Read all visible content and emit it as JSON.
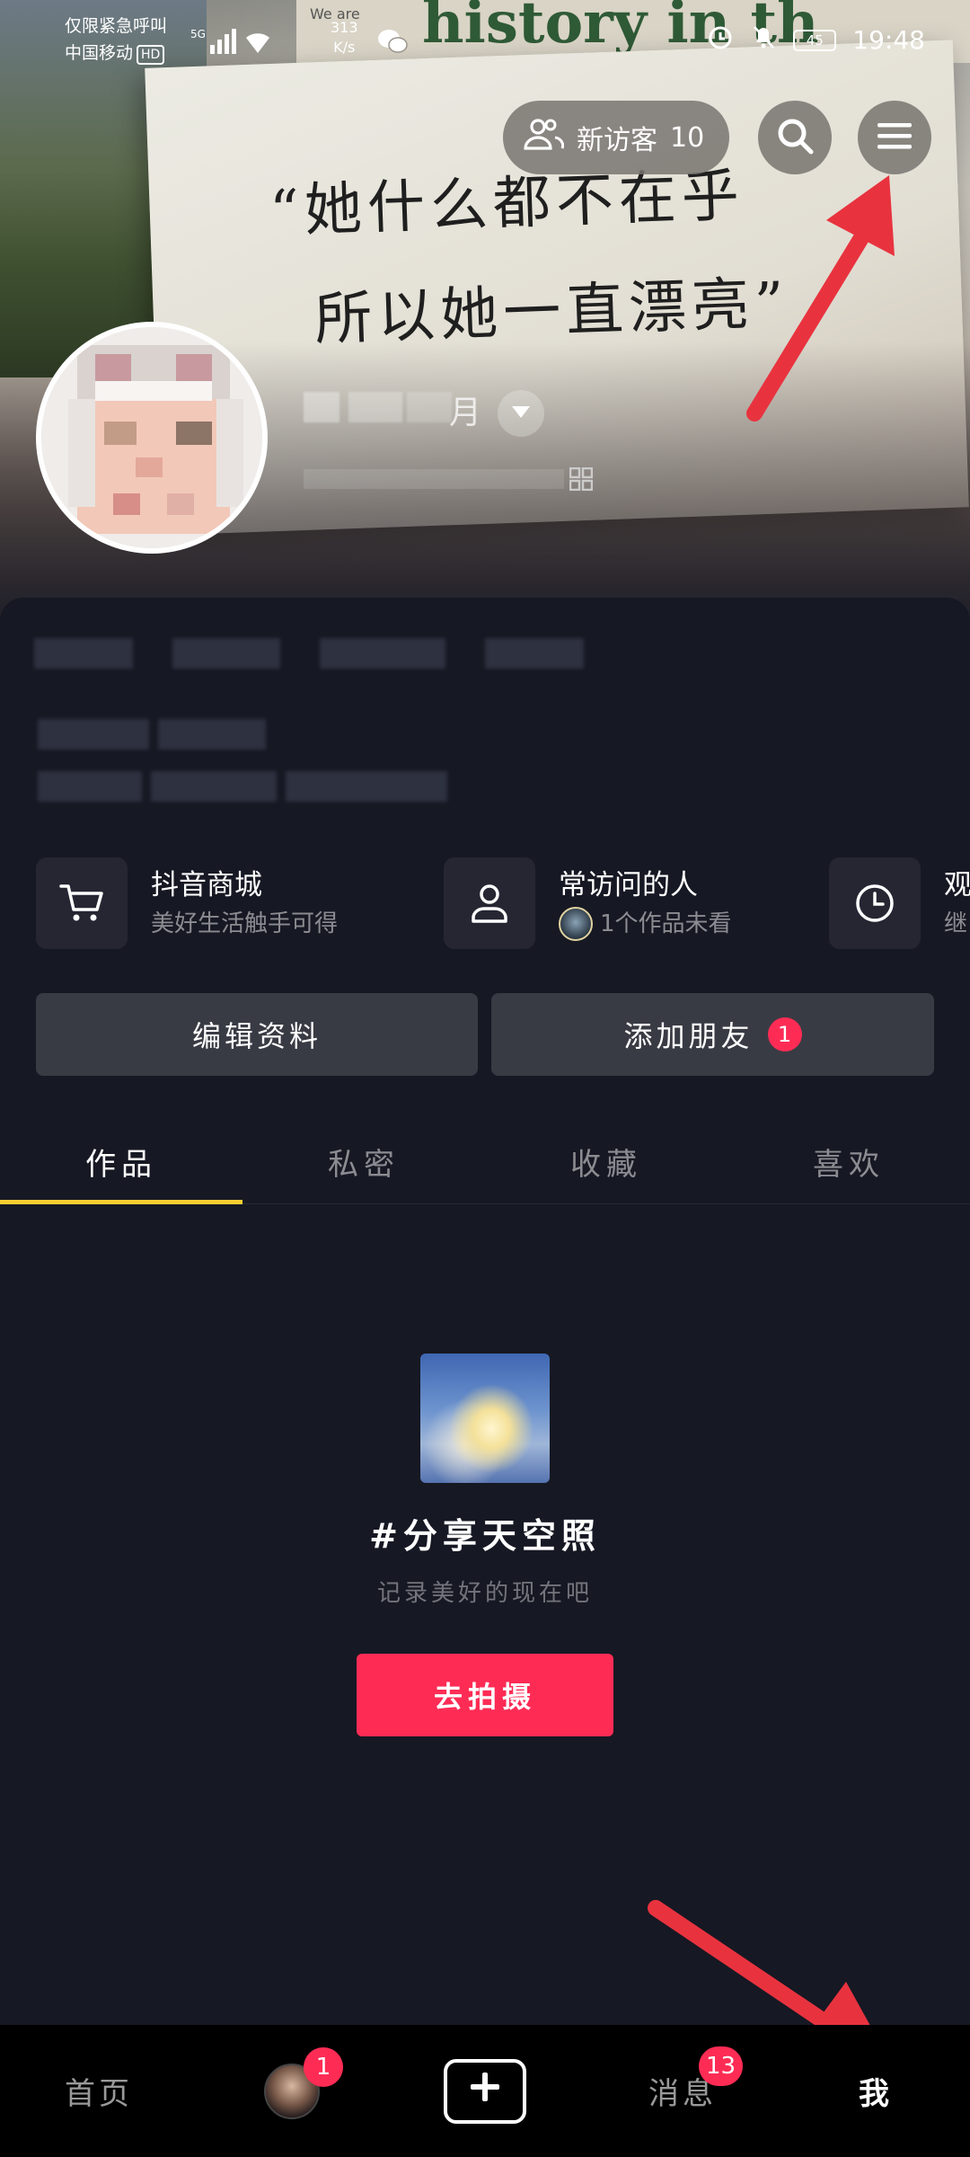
{
  "status_bar": {
    "emergency_text": "仅限紧急呼叫",
    "carrier": "中国移动",
    "hd_label": "HD",
    "network_label": "5G",
    "speed_value": "313",
    "speed_unit": "K/s",
    "battery": "45",
    "time": "19:48"
  },
  "cover": {
    "book_title": "history in th",
    "book_tag": "We are",
    "quote_line1": "“她什么都不在乎",
    "quote_line2": "所以她一直漂亮”"
  },
  "header": {
    "visitors_label": "新访客",
    "visitors_count": "10",
    "nickname_partial": "月"
  },
  "quick_entries": [
    {
      "title": "抖音商城",
      "subtitle": "美好生活触手可得",
      "icon": "cart-icon"
    },
    {
      "title": "常访问的人",
      "subtitle": "1个作品未看",
      "icon": "person-icon"
    },
    {
      "title": "观",
      "subtitle": "继",
      "icon": "clock-icon"
    }
  ],
  "actions": {
    "edit_profile": "编辑资料",
    "add_friend": "添加朋友",
    "add_friend_badge": "1"
  },
  "tabs": [
    {
      "label": "作品",
      "active": true
    },
    {
      "label": "私密",
      "active": false
    },
    {
      "label": "收藏",
      "active": false
    },
    {
      "label": "喜欢",
      "active": false
    }
  ],
  "empty_state": {
    "title": "#分享天空照",
    "subtitle": "记录美好的现在吧",
    "button": "去拍摄"
  },
  "bottom_nav": {
    "home": "首页",
    "friends_badge": "1",
    "messages": "消息",
    "messages_badge": "13",
    "me": "我"
  },
  "colors": {
    "background": "#161823",
    "accent_red": "#fe2c55",
    "tab_indicator": "#facd32",
    "card_bg": "#252632",
    "button_bg": "#393b44"
  }
}
